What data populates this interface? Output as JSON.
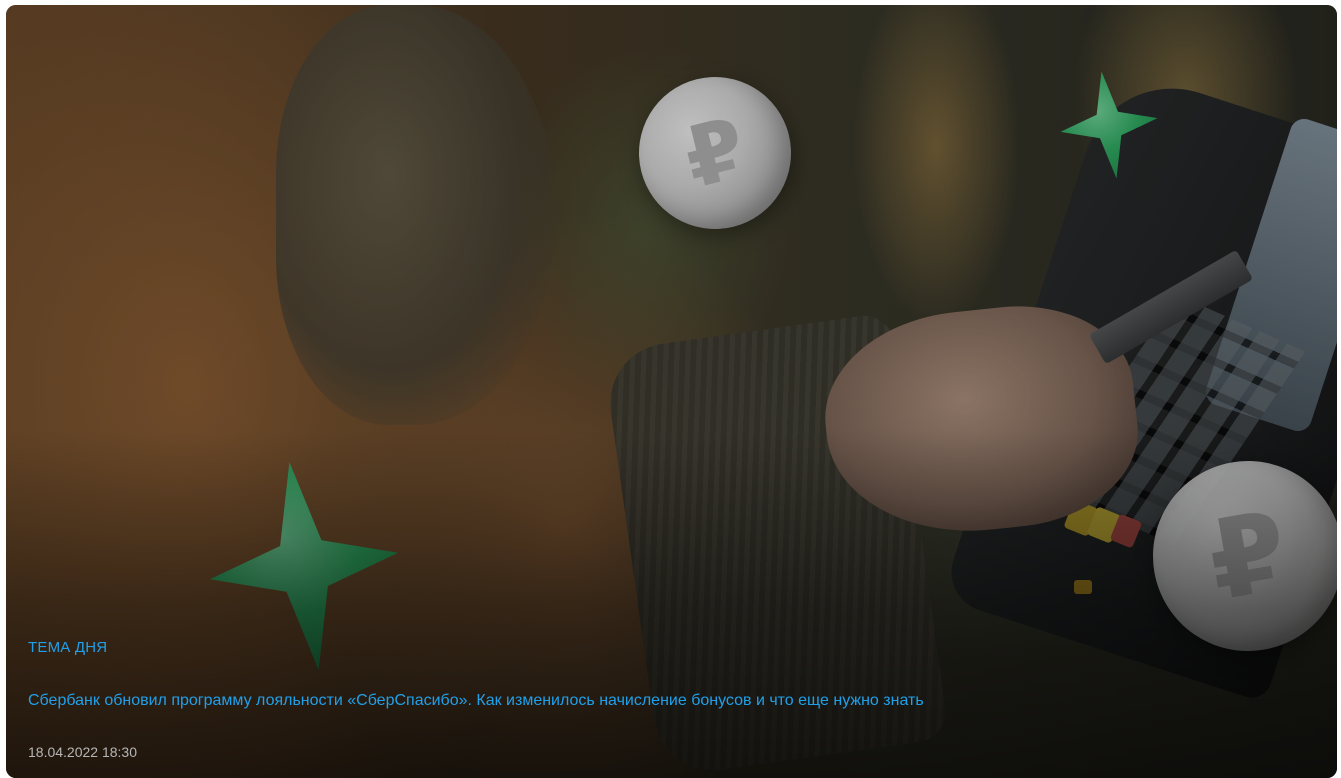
{
  "card": {
    "tag": "ТЕМА ДНЯ",
    "headline": "Сбербанк обновил программу лояльности «СберСпасибо». Как изменилось начисление бонусов и что еще нужно знать",
    "date": "18.04.2022 18:30"
  },
  "decorations": {
    "coin_symbol": "₽",
    "icons": [
      "ruble-coin-icon",
      "green-star-icon"
    ]
  },
  "colors": {
    "accent": "#21a0ea",
    "date": "#b6b6b6",
    "star": "#33b86a"
  }
}
